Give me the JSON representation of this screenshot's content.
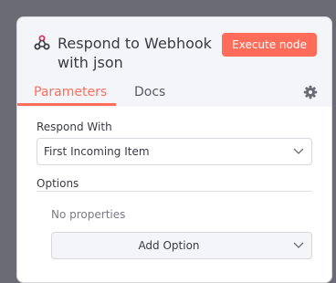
{
  "node": {
    "title": "Respond to Webhook with json",
    "execute_label": "Execute node"
  },
  "tabs": [
    {
      "label": "Parameters",
      "active": true
    },
    {
      "label": "Docs",
      "active": false
    }
  ],
  "params": {
    "respond_with_label": "Respond With",
    "respond_with_value": "First Incoming Item",
    "options_label": "Options",
    "no_properties": "No properties",
    "add_option_label": "Add Option"
  },
  "colors": {
    "accent": "#ff6d5a",
    "header_bg": "#f4f5f8",
    "text": "#3a3a45"
  },
  "icons": {
    "node": "webhook-icon",
    "settings": "gear-icon",
    "dropdown": "chevron-down-icon"
  }
}
